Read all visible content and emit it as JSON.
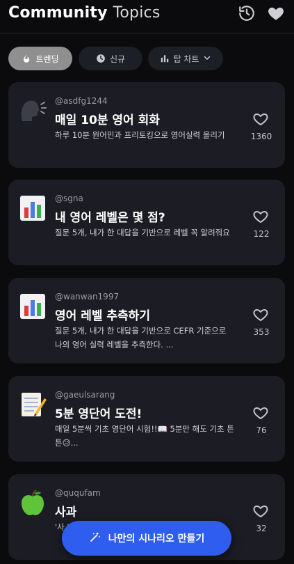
{
  "header": {
    "title_part1": "Community",
    "title_part2": "Topics",
    "icons": [
      "history-icon",
      "heart-icon"
    ]
  },
  "filters": [
    {
      "label": "트렌딩",
      "icon": "flame-icon",
      "active": true
    },
    {
      "label": "신규",
      "icon": "clock-icon",
      "active": false
    },
    {
      "label": "탑 차트",
      "icon": "bar-chart-icon",
      "active": false
    }
  ],
  "cards": [
    {
      "emoji": "speaking-head",
      "user": "@asdfg1244",
      "title": "매일 10분 영어 회화",
      "desc": "하루 10분 원어민과 프리토킹으로 영어실력 올리기",
      "likes": "1360"
    },
    {
      "emoji": "bar-chart",
      "user": "@sgna",
      "title": "내 영어 레벨은 몇 점?",
      "desc": "질문 5개, 내가 한 대답을 기반으로 레벨 꼭 알려줘요",
      "likes": "122"
    },
    {
      "emoji": "bar-chart",
      "user": "@wanwan1997",
      "title": "영어 레벨 추측하기",
      "desc": "질문 5개, 내가 한 대답을 기반으로 CEFR 기준으로 나의 영어 실력 레벨을 추측한다. ...",
      "likes": "353"
    },
    {
      "emoji": "memo",
      "user": "@gaeulsarang",
      "title": "5분 영단어 도전!",
      "desc": "매일 5분씩 기초 영단어 시험!!📖 5분만 해도 기초 튼튼😥...",
      "likes": "76"
    },
    {
      "emoji": "green-apple",
      "user": "@ququfam",
      "title": "사과",
      "desc": "'사 빈",
      "likes": "32"
    }
  ],
  "cta": {
    "label": "나만의 시나리오 만들기",
    "icon": "magic-wand-icon"
  },
  "colors": {
    "background": "#0b0b0d",
    "card": "#1c1d24",
    "cta": "#2f5df0",
    "chip_active": "#8f8f90"
  }
}
